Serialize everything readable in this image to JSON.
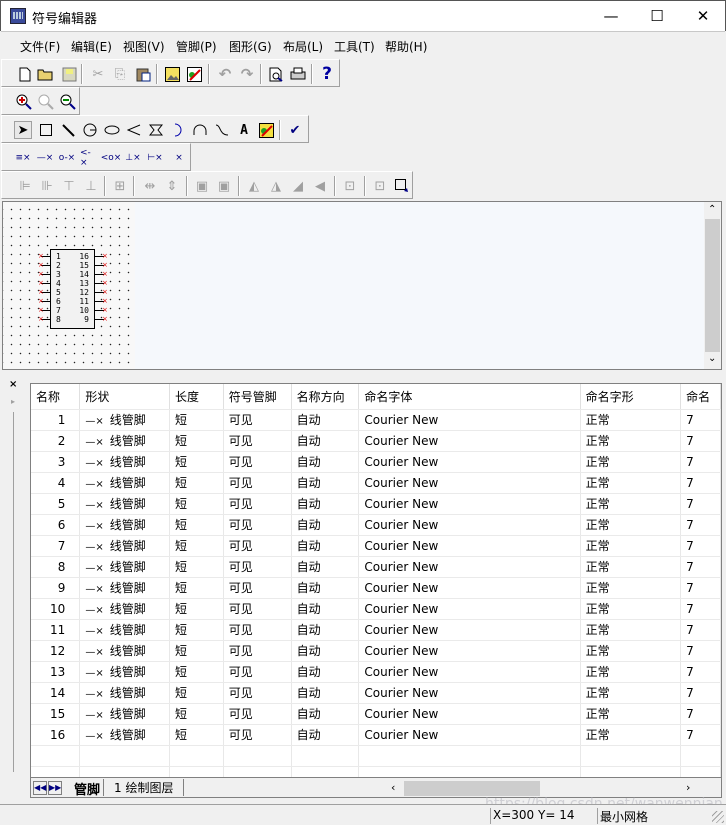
{
  "window": {
    "title": "符号编辑器",
    "minimize": "—",
    "maximize": "☐",
    "close": "✕"
  },
  "menu": [
    "文件(F)",
    "编辑(E)",
    "视图(V)",
    "管脚(P)",
    "图形(G)",
    "布局(L)",
    "工具(T)",
    "帮助(H)"
  ],
  "toolbar_standard": [
    "new-file",
    "open-folder",
    "save",
    "cut",
    "copy",
    "paste",
    "insert-image",
    "edit-properties",
    "undo",
    "redo",
    "print-preview",
    "print",
    "help"
  ],
  "toolbar_zoom": [
    "zoom-in",
    "zoom-fit",
    "zoom-out"
  ],
  "toolbar_draw": [
    "select",
    "rectangle",
    "line",
    "circle",
    "ellipse",
    "polyline",
    "polygon",
    "arc",
    "semi-arc",
    "bezier",
    "text",
    "properties",
    "check"
  ],
  "toolbar_pins": [
    "multi-pin",
    "line-pin",
    "dot-pin",
    "clock-pin",
    "dot-clock-pin",
    "short-pin",
    "long-pin",
    "no-connect"
  ],
  "text_glyph": "A",
  "help_glyph": "?",
  "chip": {
    "left_pins": [
      "1",
      "2",
      "3",
      "4",
      "5",
      "6",
      "7",
      "8"
    ],
    "right_pins": [
      "16",
      "15",
      "14",
      "13",
      "12",
      "11",
      "10",
      "9"
    ]
  },
  "table": {
    "headers": [
      "名称",
      "形状",
      "长度",
      "符号管脚",
      "名称方向",
      "命名字体",
      "命名字形",
      "命名"
    ],
    "rows": [
      {
        "name": "1",
        "shape": "线管脚",
        "length": "短",
        "visible": "可见",
        "dir": "自动",
        "font": "Courier New",
        "style": "正常",
        "size": "7"
      },
      {
        "name": "2",
        "shape": "线管脚",
        "length": "短",
        "visible": "可见",
        "dir": "自动",
        "font": "Courier New",
        "style": "正常",
        "size": "7"
      },
      {
        "name": "3",
        "shape": "线管脚",
        "length": "短",
        "visible": "可见",
        "dir": "自动",
        "font": "Courier New",
        "style": "正常",
        "size": "7"
      },
      {
        "name": "4",
        "shape": "线管脚",
        "length": "短",
        "visible": "可见",
        "dir": "自动",
        "font": "Courier New",
        "style": "正常",
        "size": "7"
      },
      {
        "name": "5",
        "shape": "线管脚",
        "length": "短",
        "visible": "可见",
        "dir": "自动",
        "font": "Courier New",
        "style": "正常",
        "size": "7"
      },
      {
        "name": "6",
        "shape": "线管脚",
        "length": "短",
        "visible": "可见",
        "dir": "自动",
        "font": "Courier New",
        "style": "正常",
        "size": "7"
      },
      {
        "name": "7",
        "shape": "线管脚",
        "length": "短",
        "visible": "可见",
        "dir": "自动",
        "font": "Courier New",
        "style": "正常",
        "size": "7"
      },
      {
        "name": "8",
        "shape": "线管脚",
        "length": "短",
        "visible": "可见",
        "dir": "自动",
        "font": "Courier New",
        "style": "正常",
        "size": "7"
      },
      {
        "name": "9",
        "shape": "线管脚",
        "length": "短",
        "visible": "可见",
        "dir": "自动",
        "font": "Courier New",
        "style": "正常",
        "size": "7"
      },
      {
        "name": "10",
        "shape": "线管脚",
        "length": "短",
        "visible": "可见",
        "dir": "自动",
        "font": "Courier New",
        "style": "正常",
        "size": "7"
      },
      {
        "name": "11",
        "shape": "线管脚",
        "length": "短",
        "visible": "可见",
        "dir": "自动",
        "font": "Courier New",
        "style": "正常",
        "size": "7"
      },
      {
        "name": "12",
        "shape": "线管脚",
        "length": "短",
        "visible": "可见",
        "dir": "自动",
        "font": "Courier New",
        "style": "正常",
        "size": "7"
      },
      {
        "name": "13",
        "shape": "线管脚",
        "length": "短",
        "visible": "可见",
        "dir": "自动",
        "font": "Courier New",
        "style": "正常",
        "size": "7"
      },
      {
        "name": "14",
        "shape": "线管脚",
        "length": "短",
        "visible": "可见",
        "dir": "自动",
        "font": "Courier New",
        "style": "正常",
        "size": "7"
      },
      {
        "name": "15",
        "shape": "线管脚",
        "length": "短",
        "visible": "可见",
        "dir": "自动",
        "font": "Courier New",
        "style": "正常",
        "size": "7"
      },
      {
        "name": "16",
        "shape": "线管脚",
        "length": "短",
        "visible": "可见",
        "dir": "自动",
        "font": "Courier New",
        "style": "正常",
        "size": "7"
      }
    ],
    "pin_glyph": "—×"
  },
  "sheet_tabs": [
    "管脚",
    "1  绘制图层"
  ],
  "panel_close": "×",
  "status": {
    "coords": "X=300 Y= 14",
    "grid": "最小网格"
  },
  "watermark": "https://blog.csdn.net/wanwennian"
}
